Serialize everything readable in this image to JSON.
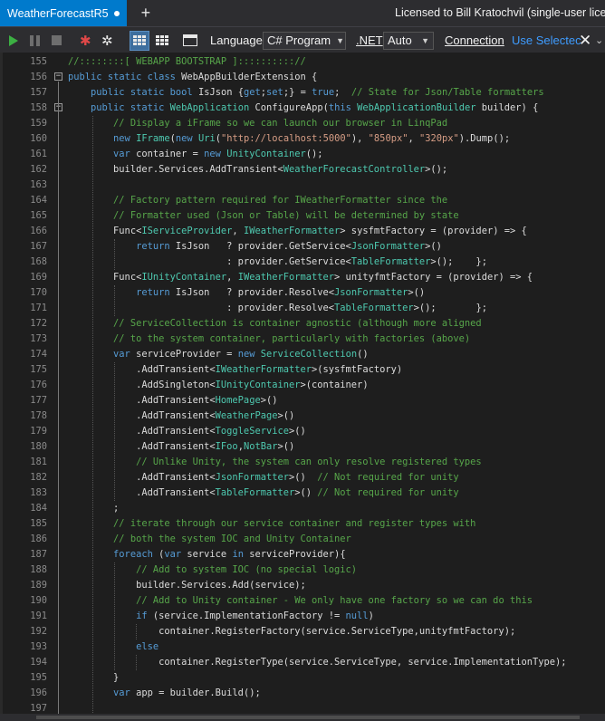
{
  "tab": {
    "title": "WeatherForecastR5"
  },
  "license_text": "Licensed to Bill Kratochvil (single-user licens",
  "toolbar": {
    "language_label": "Language",
    "language_value": "C# Program",
    "net_label": ".NET",
    "net_value": "Auto",
    "connection_label": "Connection",
    "use_selected_label": "Use Selectec"
  },
  "code_lines": [
    {
      "n": "155",
      "t": "//::::::::[ WEBAPP BOOTSTRAP ]:::::::::://"
    },
    {
      "n": "156",
      "t": "public static class WebAppBuilderExtension {"
    },
    {
      "n": "157",
      "t": "    public static bool IsJson {get;set;} = true;  // State for Json/Table formatters"
    },
    {
      "n": "158",
      "t": "    public static WebApplication ConfigureApp(this WebApplicationBuilder builder) {"
    },
    {
      "n": "159",
      "t": "        // Display a iFrame so we can launch our browser in LinqPad"
    },
    {
      "n": "160",
      "t": "        new IFrame(new Uri(\"http://localhost:5000\"), \"850px\", \"320px\").Dump();"
    },
    {
      "n": "161",
      "t": "        var container = new UnityContainer();"
    },
    {
      "n": "162",
      "t": "        builder.Services.AddTransient<WeatherForecastController>();"
    },
    {
      "n": "163",
      "t": ""
    },
    {
      "n": "164",
      "t": "        // Factory pattern required for IWeatherFormatter since the"
    },
    {
      "n": "165",
      "t": "        // Formatter used (Json or Table) will be determined by state"
    },
    {
      "n": "166",
      "t": "        Func<IServiceProvider, IWeatherFormatter> sysfmtFactory = (provider) => {"
    },
    {
      "n": "167",
      "t": "            return IsJson   ? provider.GetService<JsonFormatter>()"
    },
    {
      "n": "168",
      "t": "                            : provider.GetService<TableFormatter>();    };"
    },
    {
      "n": "169",
      "t": "        Func<IUnityContainer, IWeatherFormatter> unityfmtFactory = (provider) => {"
    },
    {
      "n": "170",
      "t": "            return IsJson   ? provider.Resolve<JsonFormatter>()"
    },
    {
      "n": "171",
      "t": "                            : provider.Resolve<TableFormatter>();       };"
    },
    {
      "n": "172",
      "t": "        // ServiceCollection is container agnostic (although more aligned"
    },
    {
      "n": "173",
      "t": "        // to the system container, particularly with factories (above)"
    },
    {
      "n": "174",
      "t": "        var serviceProvider = new ServiceCollection()"
    },
    {
      "n": "175",
      "t": "            .AddTransient<IWeatherFormatter>(sysfmtFactory)"
    },
    {
      "n": "176",
      "t": "            .AddSingleton<IUnityContainer>(container)"
    },
    {
      "n": "177",
      "t": "            .AddTransient<HomePage>()"
    },
    {
      "n": "178",
      "t": "            .AddTransient<WeatherPage>()"
    },
    {
      "n": "179",
      "t": "            .AddTransient<ToggleService>()"
    },
    {
      "n": "180",
      "t": "            .AddTransient<IFoo,NotBar>()"
    },
    {
      "n": "181",
      "t": "            // Unlike Unity, the system can only resolve registered types"
    },
    {
      "n": "182",
      "t": "            .AddTransient<JsonFormatter>()  // Not required for unity"
    },
    {
      "n": "183",
      "t": "            .AddTransient<TableFormatter>() // Not required for unity"
    },
    {
      "n": "184",
      "t": "        ;"
    },
    {
      "n": "185",
      "t": "        // iterate through our service container and register types with"
    },
    {
      "n": "186",
      "t": "        // both the system IOC and Unity Container"
    },
    {
      "n": "187",
      "t": "        foreach (var service in serviceProvider){"
    },
    {
      "n": "188",
      "t": "            // Add to system IOC (no special logic)"
    },
    {
      "n": "189",
      "t": "            builder.Services.Add(service);"
    },
    {
      "n": "190",
      "t": "            // Add to Unity container - We only have one factory so we can do this"
    },
    {
      "n": "191",
      "t": "            if (service.ImplementationFactory != null)"
    },
    {
      "n": "192",
      "t": "                container.RegisterFactory(service.ServiceType,unityfmtFactory);"
    },
    {
      "n": "193",
      "t": "            else"
    },
    {
      "n": "194",
      "t": "                container.RegisterType(service.ServiceType, service.ImplementationType);"
    },
    {
      "n": "195",
      "t": "        }"
    },
    {
      "n": "196",
      "t": "        var app = builder.Build();"
    },
    {
      "n": "197",
      "t": ""
    }
  ],
  "colors": {
    "keyword": "#569cd6",
    "type": "#4ec9b0",
    "string": "#d69d85",
    "comment": "#57a64a",
    "tab_active": "#007acc"
  },
  "icons": [
    "play-icon",
    "pause-icon",
    "stop-icon",
    "bug-icon",
    "bug-outline-icon",
    "results-grid-icon",
    "data-grid-icon",
    "panel-icon",
    "close-icon",
    "chevron-down-icon"
  ]
}
